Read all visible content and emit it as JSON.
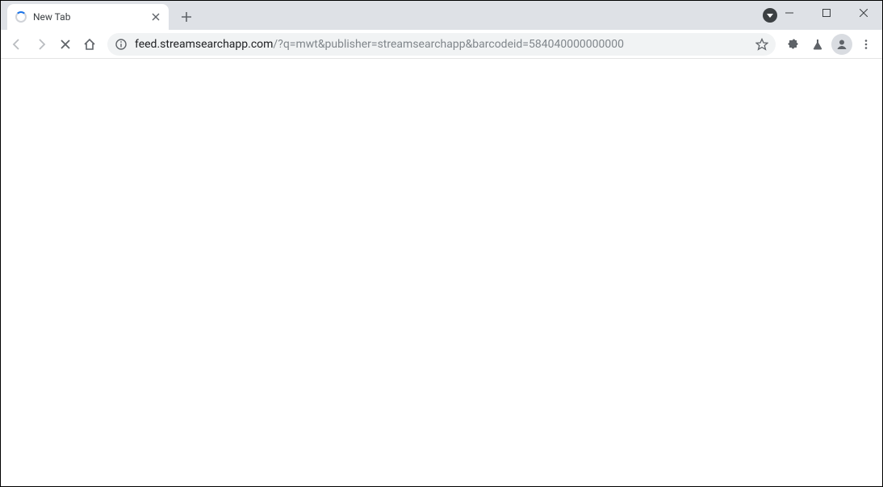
{
  "tab": {
    "title": "New Tab",
    "loading": true
  },
  "url": {
    "host": "feed.streamsearchapp.com",
    "path": "/?q=mwt&publisher=streamsearchapp&barcodeid=584040000000000"
  },
  "icons": {
    "back": "back-icon",
    "forward": "forward-icon",
    "stop": "close-icon",
    "home": "home-icon",
    "info": "info-icon",
    "star": "star-icon",
    "extensions": "puzzle-icon",
    "labs": "flask-icon",
    "profile": "person-icon",
    "menu": "dots-vertical-icon",
    "newtab": "plus-icon",
    "minimize": "minimize-icon",
    "maximize": "maximize-icon",
    "closewin": "close-icon",
    "tabclose": "close-icon",
    "toolbardot": "triangle-down-icon"
  }
}
